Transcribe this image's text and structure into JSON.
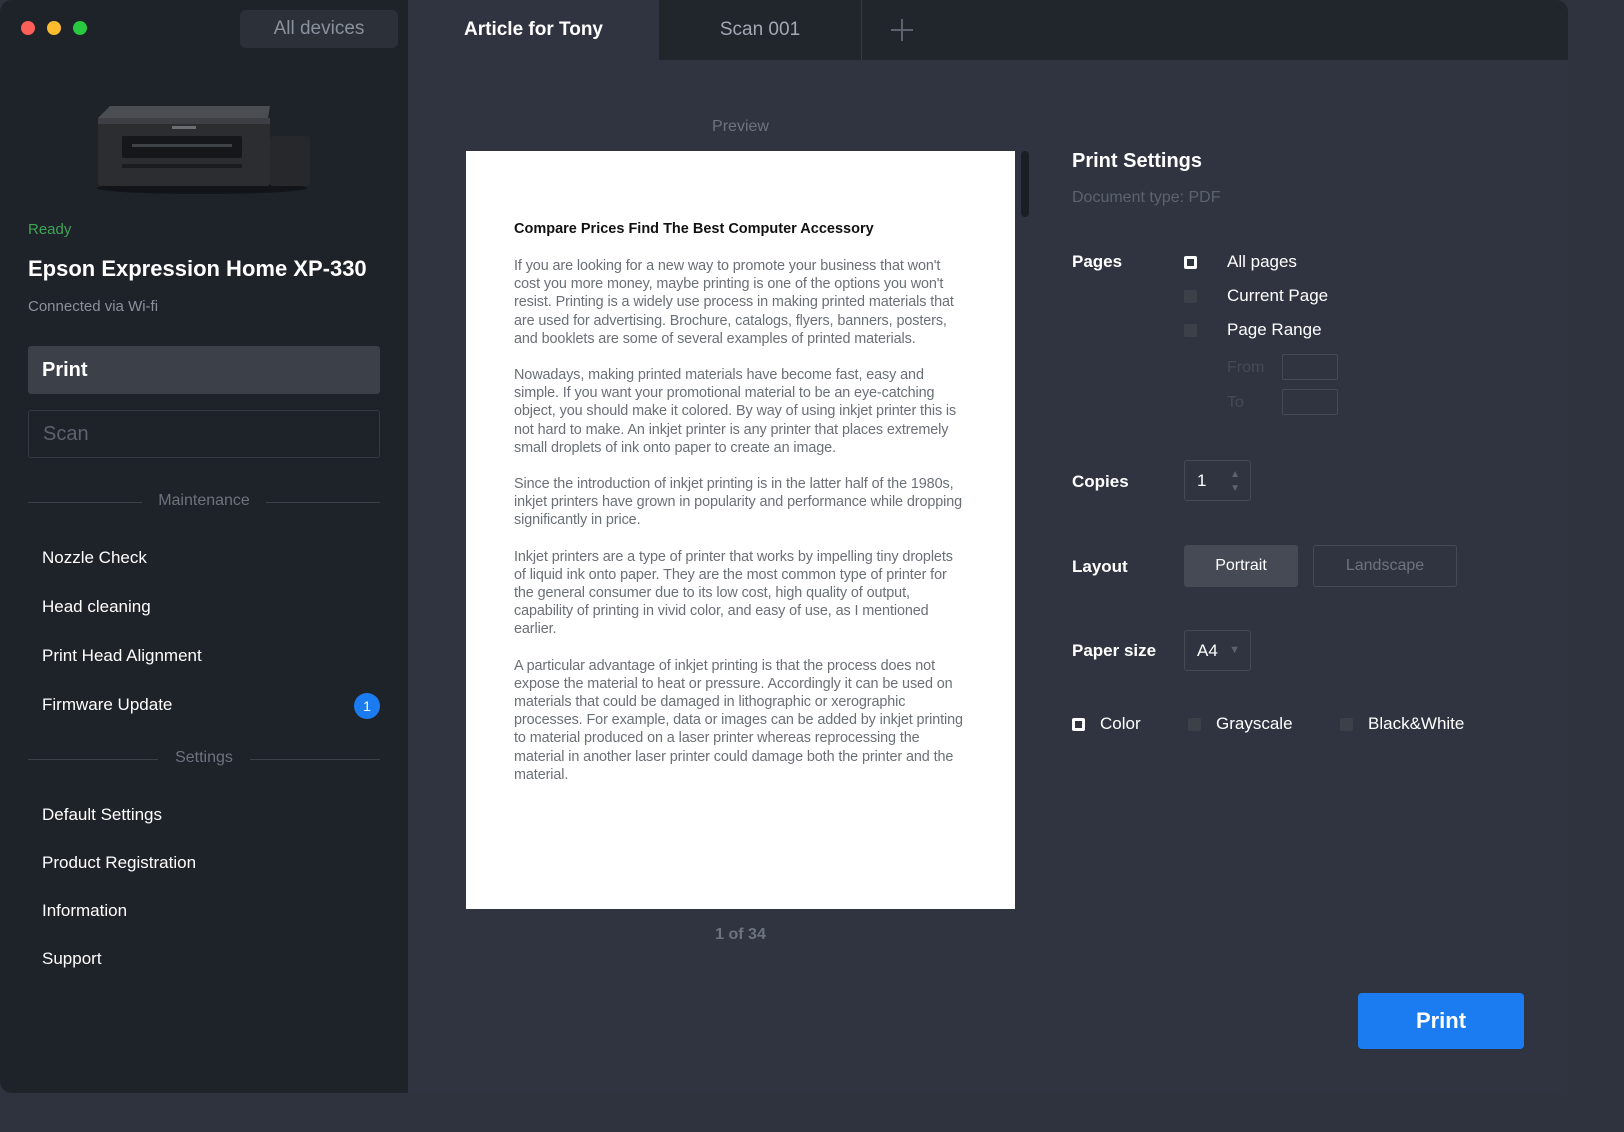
{
  "sidebar": {
    "all_devices_label": "All devices",
    "printer_status": "Ready",
    "printer_name": "Epson Expression Home XP-330",
    "connection": "Connected via Wi-fi",
    "print_label": "Print",
    "scan_label": "Scan",
    "maintenance_heading": "Maintenance",
    "maintenance_items": [
      {
        "label": "Nozzle Check"
      },
      {
        "label": "Head cleaning"
      },
      {
        "label": "Print Head Alignment"
      },
      {
        "label": "Firmware Update",
        "badge": "1"
      }
    ],
    "settings_heading": "Settings",
    "settings_items": [
      {
        "label": "Default Settings"
      },
      {
        "label": "Product Registration"
      },
      {
        "label": "Information"
      },
      {
        "label": "Support"
      }
    ]
  },
  "tabs": [
    {
      "label": "Article for Tony",
      "active": true
    },
    {
      "label": "Scan 001",
      "active": false
    }
  ],
  "preview": {
    "label": "Preview",
    "page_indicator": "1  of 34",
    "doc_title": "Compare Prices Find The Best Computer Accessory",
    "paragraphs": [
      "If you are looking for a new way to promote your business that won't cost you more money, maybe printing is one of the options you won't resist. Printing is a widely use process in making printed materials that are used for advertising. Brochure, catalogs, flyers, banners, posters, and booklets are some of several examples of printed materials.",
      "Nowadays, making printed materials have become fast, easy and simple. If you want your promotional material to be an eye-catching object, you should make it colored. By way of using inkjet printer this is not hard to make. An inkjet printer is any printer that places extremely small droplets of ink onto paper to create an image.",
      "Since the introduction of inkjet printing is in the latter half of the 1980s, inkjet printers have grown in popularity and performance while dropping significantly in price.",
      "Inkjet printers are a type of printer that works by impelling tiny droplets of liquid ink onto paper. They are the most common type of printer for the general consumer due to its low cost, high quality of output, capability of printing in vivid color, and easy of use, as I mentioned earlier.",
      "A particular advantage of inkjet printing is that the process does not expose the material to heat or pressure. Accordingly it can be used on materials that could be damaged in lithographic or xerographic processes. For example, data or images can be added by inkjet printing to material produced on a laser printer whereas reprocessing the material in another laser printer could damage both the printer and the material."
    ]
  },
  "settings": {
    "title": "Print Settings",
    "doc_type": "Document type: PDF",
    "pages_label": "Pages",
    "pages_options": [
      "All pages",
      "Current Page",
      "Page Range"
    ],
    "pages_selected": "All pages",
    "from_label": "From",
    "to_label": "To",
    "copies_label": "Copies",
    "copies_value": "1",
    "layout_label": "Layout",
    "layout_options": [
      "Portrait",
      "Landscape"
    ],
    "layout_selected": "Portrait",
    "paper_size_label": "Paper size",
    "paper_size_value": "A4",
    "color_options": [
      "Color",
      "Grayscale",
      "Black&White"
    ],
    "color_selected": "Color",
    "print_button": "Print"
  },
  "colors": {
    "accent": "#1a7cf0",
    "ready": "#3fa556",
    "sidebar_bg": "#1e2229",
    "main_bg": "#2f3440"
  }
}
